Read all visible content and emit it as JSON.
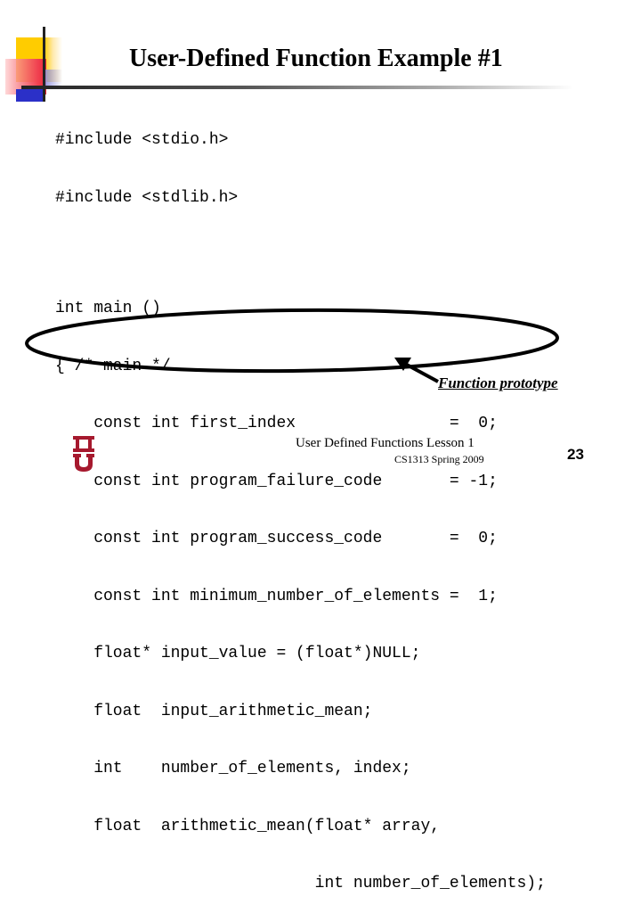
{
  "slide": {
    "title": "User-Defined Function Example #1",
    "code_lines": [
      "#include <stdio.h>",
      "#include <stdlib.h>",
      "",
      "int main ()",
      "{ /* main */",
      "    const int first_index                =  0;",
      "    const int program_failure_code       = -1;",
      "    const int program_success_code       =  0;",
      "    const int minimum_number_of_elements =  1;",
      "    float* input_value = (float*)NULL;",
      "    float  input_arithmetic_mean;",
      "    int    number_of_elements, index;",
      "    float  arithmetic_mean(float* array,",
      "                           int number_of_elements);"
    ],
    "annotation": "Function prototype",
    "highlight_color": "#000000"
  },
  "footer": {
    "lesson": "User Defined Functions Lesson 1",
    "course": "CS1313 Spring 2009",
    "page_number": "23",
    "logo_color": "#a6192e"
  },
  "decoration": {
    "yellow": "#ffcc00",
    "red": "#e82838",
    "blue": "#2b30c8"
  }
}
